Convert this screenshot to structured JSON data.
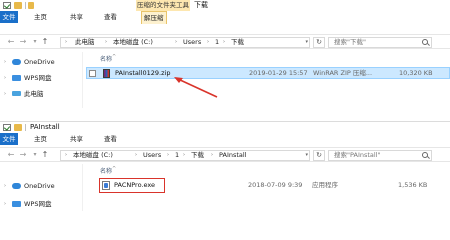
{
  "window1": {
    "context_tab": "压缩的文件夹工具",
    "title": "下载",
    "ribbon_tabs": [
      "文件",
      "主页",
      "共享",
      "查看",
      "解压缩"
    ],
    "breadcrumb": [
      "此电脑",
      "本地磁盘 (C:)",
      "Users",
      "1",
      "下载"
    ],
    "search_placeholder": "搜索\"下载\"",
    "nav_items": [
      "OneDrive",
      "WPS网盘",
      "此电脑"
    ],
    "column_name": "名称",
    "file": {
      "name": "PAInstall0129.zip",
      "date": "2019-01-29 15:57",
      "type": "WinRAR ZIP 压缩...",
      "size": "10,320 KB"
    }
  },
  "window2": {
    "title": "PAInstall",
    "breadcrumb": [
      "本地磁盘 (C:)",
      "Users",
      "1",
      "下载",
      "PAInstall"
    ],
    "search_placeholder": "搜索\"PAInstall\"",
    "nav_items": [
      "OneDrive",
      "WPS网盘"
    ],
    "column_name": "名称",
    "file": {
      "name": "PACNPro.exe",
      "date": "2018-07-09 9:39",
      "type": "应用程序",
      "size": "1,536 KB"
    }
  },
  "icons": {
    "back": "←",
    "forward": "→",
    "up": "↑",
    "dropdown": "▾",
    "refresh": "↻",
    "chevron": "›",
    "expand": "›"
  },
  "colors": {
    "accent": "#1a6fc9",
    "selection": "#cce8ff",
    "highlight": "#d9342b",
    "context_tab": "#fde7b0"
  }
}
